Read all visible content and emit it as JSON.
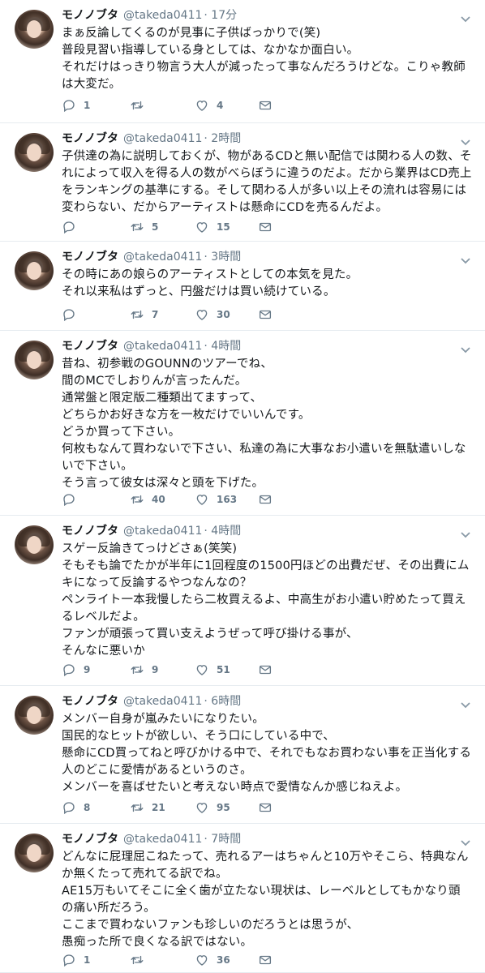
{
  "tweets": [
    {
      "name": "モノノブタ",
      "handle": "@takeda0411",
      "time": "· 17分",
      "text": "まぁ反論してくるのが見事に子供ばっかりで(笑)\n普段見習い指導している身としては、なかなか面白い。\nそれだけはっきり物言う大人が減ったって事なんだろうけどな。こりゃ教師は大変だ。",
      "replies": "1",
      "retweets": "",
      "likes": "4"
    },
    {
      "name": "モノノブタ",
      "handle": "@takeda0411",
      "time": "· 2時間",
      "text": "子供達の為に説明しておくが、物があるCDと無い配信では関わる人の数、それによって収入を得る人の数がべらぼうに違うのだよ。だから業界はCD売上をランキングの基準にする。そして関わる人が多い以上その流れは容易には変わらない、だからアーティストは懸命にCDを売るんだよ。",
      "replies": "",
      "retweets": "5",
      "likes": "15"
    },
    {
      "name": "モノノブタ",
      "handle": "@takeda0411",
      "time": "· 3時間",
      "text": "その時にあの娘らのアーティストとしての本気を見た。\nそれ以来私はずっと、円盤だけは買い続けている。",
      "replies": "",
      "retweets": "7",
      "likes": "30"
    },
    {
      "name": "モノノブタ",
      "handle": "@takeda0411",
      "time": "· 4時間",
      "text": "昔ね、初参戦のGOUNNのツアーでね、\n間のMCでしおりんが言ったんだ。\n通常盤と限定版二種類出てますって、\nどちらかお好きな方を一枚だけでいいんです。\nどうか買って下さい。\n何枚もなんて買わないで下さい、私達の為に大事なお小遣いを無駄遣いしないで下さい。\nそう言って彼女は深々と頭を下げた。",
      "replies": "",
      "retweets": "40",
      "likes": "163"
    },
    {
      "name": "モノノブタ",
      "handle": "@takeda0411",
      "time": "· 4時間",
      "text": "スゲー反論きてっけどさぁ(笑笑)\nそもそも論でたかが半年に1回程度の1500円ほどの出費だぜ、その出費にムキになって反論するやつなんなの？\nペンライト一本我慢したら二枚買えるよ、中高生がお小遣い貯めたって買えるレベルだよ。\nファンが頑張って買い支えようぜって呼び掛ける事が、\nそんなに悪いか",
      "replies": "9",
      "retweets": "9",
      "likes": "51"
    },
    {
      "name": "モノノブタ",
      "handle": "@takeda0411",
      "time": "· 6時間",
      "text": "メンバー自身が嵐みたいになりたい。\n国民的なヒットが欲しい、そう口にしている中で、\n懸命にCD買ってねと呼びかける中で、それでもなお買わない事を正当化する人のどこに愛情があるというのさ。\nメンバーを喜ばせたいと考えない時点で愛情なんか感じねえよ。",
      "replies": "8",
      "retweets": "21",
      "likes": "95"
    },
    {
      "name": "モノノブタ",
      "handle": "@takeda0411",
      "time": "· 7時間",
      "text": "どんなに屁理屈こねたって、売れるアーはちゃんと10万やそこら、特典なんか無くたって売れてる訳でね。\nAE15万もいてそこに全く歯が立たない現状は、レーベルとしてもかなり頭の痛い所だろう。\nここまで買わないファンも珍しいのだろうとは思うが、\n愚痴った所で良くなる訳ではない。",
      "replies": "1",
      "retweets": "",
      "likes": "36"
    }
  ],
  "colors": {
    "text": "#14171a",
    "muted": "#657786",
    "border": "#e6ecf0"
  },
  "icons": {
    "reply": "reply-icon",
    "retweet": "retweet-icon",
    "like": "like-icon",
    "dm": "dm-icon",
    "caret": "chevron-down-icon"
  }
}
